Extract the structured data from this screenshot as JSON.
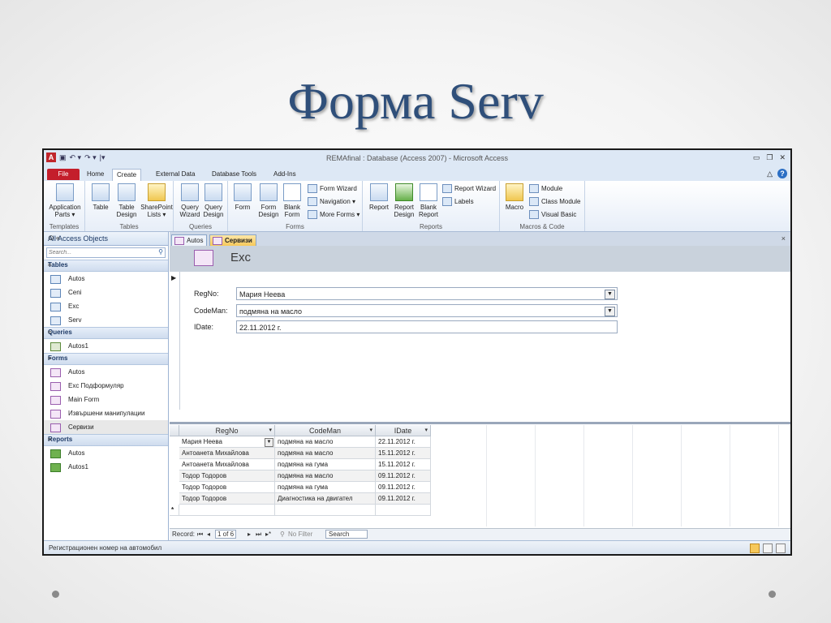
{
  "slide": {
    "title": "Форма Serv"
  },
  "window": {
    "title": "REMAfinal : Database (Access 2007)  -  Microsoft Access"
  },
  "ribbon_tabs": [
    "File",
    "Home",
    "Create",
    "External Data",
    "Database Tools",
    "Add-Ins"
  ],
  "ribbon": {
    "templates": {
      "app_parts": "Application",
      "app_parts2": "Parts ▾",
      "label": "Templates"
    },
    "tables": {
      "table": "Table",
      "table_design": "Table",
      "table_design2": "Design",
      "sharepoint": "SharePoint",
      "sharepoint2": "Lists ▾",
      "label": "Tables"
    },
    "queries": {
      "wizard": "Query",
      "wizard2": "Wizard",
      "design": "Query",
      "design2": "Design",
      "label": "Queries"
    },
    "forms": {
      "form": "Form",
      "form_design": "Form",
      "form_design2": "Design",
      "blank": "Blank",
      "blank2": "Form",
      "wizard": "Form Wizard",
      "navigation": "Navigation ▾",
      "more": "More Forms ▾",
      "label": "Forms"
    },
    "reports": {
      "report": "Report",
      "report_design": "Report",
      "report_design2": "Design",
      "blank": "Blank",
      "blank2": "Report",
      "wizard": "Report Wizard",
      "labels": "Labels",
      "label": "Reports"
    },
    "macros": {
      "macro": "Macro",
      "module": "Module",
      "class_module": "Class Module",
      "vb": "Visual Basic",
      "label": "Macros & Code"
    }
  },
  "nav": {
    "header": "All Access Objects",
    "search_placeholder": "Search...",
    "sections": {
      "tables": {
        "title": "Tables",
        "items": [
          "Autos",
          "Ceni",
          "Exc",
          "Serv"
        ]
      },
      "queries": {
        "title": "Queries",
        "items": [
          "Autos1"
        ]
      },
      "forms": {
        "title": "Forms",
        "items": [
          "Autos",
          "Exc Подформуляр",
          "Main Form",
          "Извършени манипулации",
          "Сервизи"
        ]
      },
      "reports": {
        "title": "Reports",
        "items": [
          "Autos",
          "Autos1"
        ]
      }
    }
  },
  "doc_tabs": [
    "Autos",
    "Сервизи"
  ],
  "form": {
    "header_title": "Exc",
    "fields": {
      "regno": {
        "label": "RegNo:",
        "value": "Мария Неева"
      },
      "codeman": {
        "label": "CodeMan:",
        "value": "подмяна на масло"
      },
      "idate": {
        "label": "IDate:",
        "value": "22.11.2012 г."
      }
    }
  },
  "subform": {
    "columns": [
      "RegNo",
      "CodeMan",
      "IDate"
    ],
    "rows": [
      [
        "Мария Неева",
        "подмяна на масло",
        "22.11.2012 г."
      ],
      [
        "Антоанета Михайлова",
        "подмяна на масло",
        "15.11.2012 г."
      ],
      [
        "Антоанета Михайлова",
        "подмяна на гума",
        "15.11.2012 г."
      ],
      [
        "Тодор Тодоров",
        "подмяна на масло",
        "09.11.2012 г."
      ],
      [
        "Тодор Тодоров",
        "подмяна на гума",
        "09.11.2012 г."
      ],
      [
        "Тодор Тодоров",
        "Диагностика на двигател",
        "09.11.2012 г."
      ]
    ]
  },
  "record_nav": {
    "label": "Record:",
    "position": "1 of 6",
    "filter": "No Filter",
    "search": "Search"
  },
  "status": {
    "text": "Регистрационен номер на автомобил"
  }
}
